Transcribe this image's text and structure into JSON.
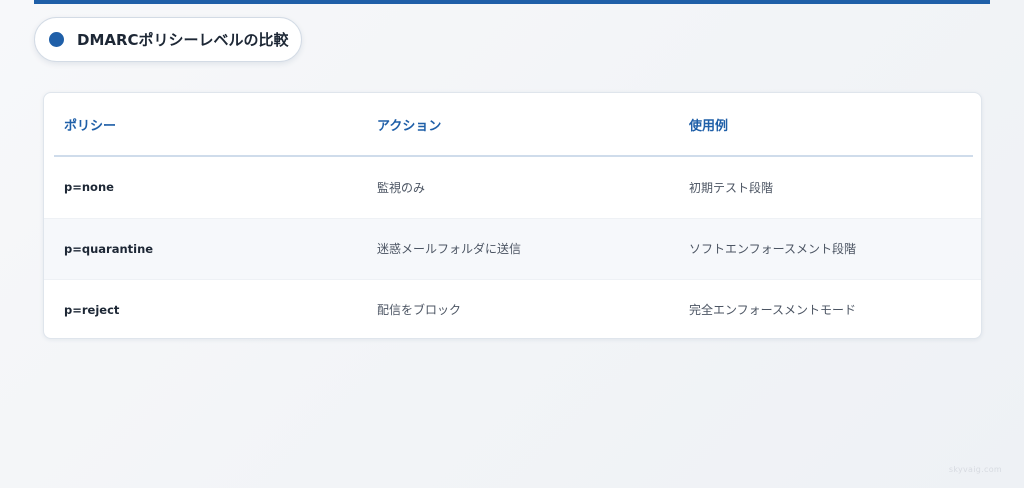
{
  "header": {
    "title": "DMARCポリシーレベルの比較"
  },
  "table": {
    "columns": [
      "ポリシー",
      "アクション",
      "使用例"
    ],
    "rows": [
      {
        "policy": "p=none",
        "action": "監視のみ",
        "example": "初期テスト段階"
      },
      {
        "policy": "p=quarantine",
        "action": "迷惑メールフォルダに送信",
        "example": "ソフトエンフォースメント段階"
      },
      {
        "policy": "p=reject",
        "action": "配信をブロック",
        "example": "完全エンフォースメントモード"
      }
    ]
  },
  "footer": {
    "watermark": "skyvaig.com"
  },
  "colors": {
    "accent": "#1f5fa8",
    "header_text": "#1f5fa8",
    "rule": "#cfdceb"
  }
}
